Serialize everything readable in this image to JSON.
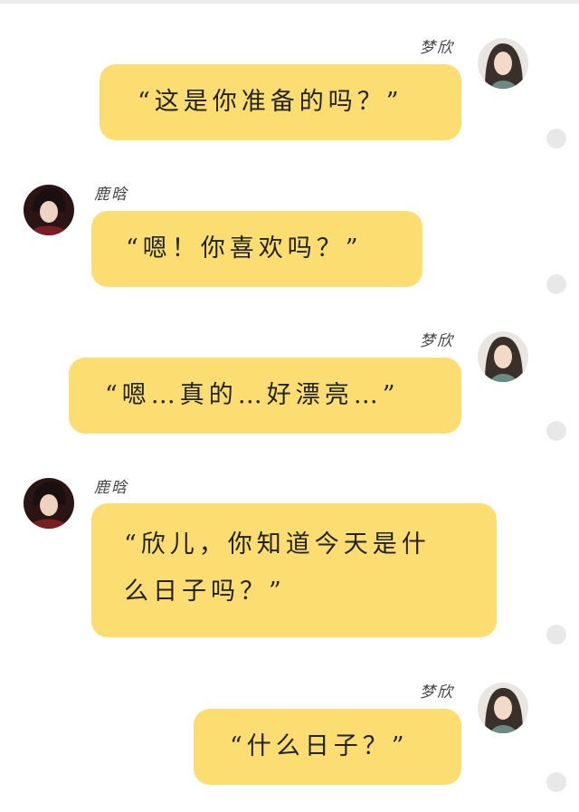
{
  "messages": [
    {
      "sender": "梦欣",
      "side": "right",
      "avatar": "female-avatar-light",
      "text": "“这是你准备的吗？”"
    },
    {
      "sender": "鹿晗",
      "side": "left",
      "avatar": "male-avatar-dark",
      "text": "“嗯！你喜欢吗？”"
    },
    {
      "sender": "梦欣",
      "side": "right",
      "avatar": "female-avatar-light",
      "text": "“嗯…真的…好漂亮…”"
    },
    {
      "sender": "鹿晗",
      "side": "left",
      "avatar": "male-avatar-dark",
      "text_lines": [
        "“欣儿，你知道今天是什",
        "么日子吗？”"
      ]
    },
    {
      "sender": "梦欣",
      "side": "right",
      "avatar": "female-avatar-light",
      "text": "“什么日子？”"
    }
  ],
  "colors": {
    "bubble": "#fcdd72",
    "status_dot": "#e8e8e8",
    "text": "#222222"
  }
}
